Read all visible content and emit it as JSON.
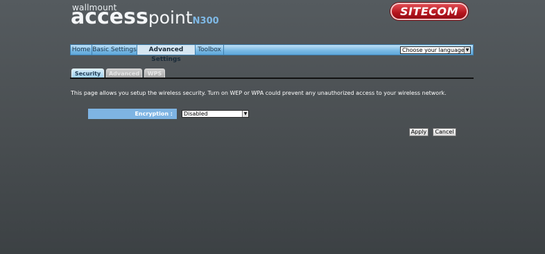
{
  "brand": {
    "small": "wallmount",
    "word1": "access",
    "word2": "point",
    "model": "N300",
    "logo": "SITECOM"
  },
  "menu": {
    "items": [
      {
        "label": "Home"
      },
      {
        "label": "Basic Settings"
      },
      {
        "label": "Advanced Settings"
      },
      {
        "label": "Toolbox"
      }
    ],
    "active": "Advanced Settings",
    "language_select": "Choose your language"
  },
  "tabs": [
    {
      "label": "Security",
      "active": true
    },
    {
      "label": "Advanced",
      "active": false
    },
    {
      "label": "WPS",
      "active": false
    }
  ],
  "description": "This page allows you setup the wireless security. Turn on WEP or WPA could prevent any unauthorized access to your wireless network.",
  "form": {
    "encryption_label": "Encryption :",
    "encryption_value": "Disabled"
  },
  "buttons": {
    "apply": "Apply",
    "cancel": "Cancel"
  },
  "colors": {
    "background": "#4b5053",
    "menu_bar": "#77b8e4",
    "label_bg": "#7eb4e3",
    "logo_red": "#b3141d",
    "model_blue": "#7fb9e6"
  }
}
